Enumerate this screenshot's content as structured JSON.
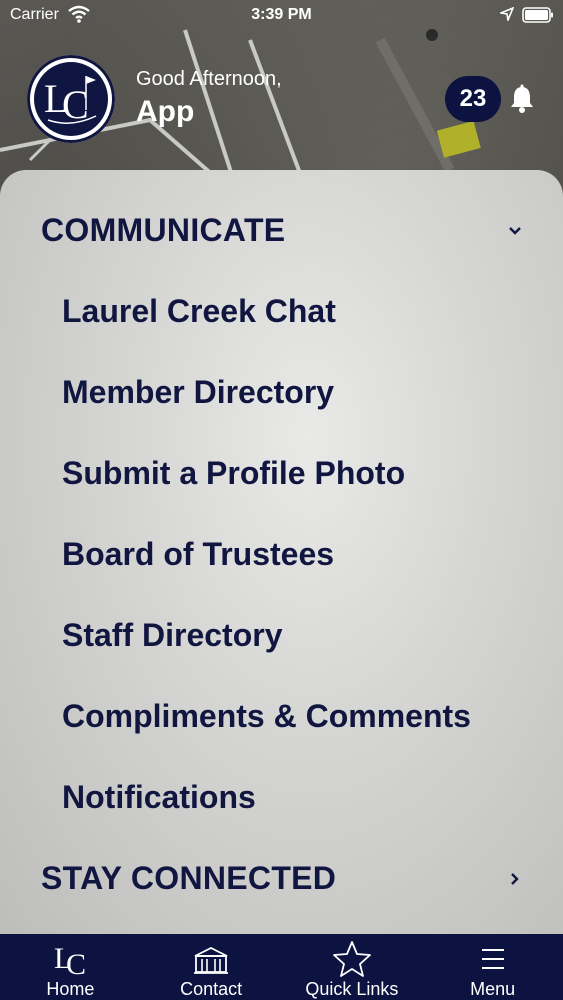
{
  "status_bar": {
    "carrier": "Carrier",
    "time": "3:39 PM"
  },
  "header": {
    "greeting": "Good Afternoon,",
    "username": "App",
    "notification_count": "23",
    "logo_text": "LC"
  },
  "menu": {
    "sections": [
      {
        "title": "COMMUNICATE",
        "expanded": true,
        "items": [
          "Laurel Creek Chat",
          "Member Directory",
          "Submit a Profile Photo",
          "Board of Trustees",
          "Staff Directory",
          "Compliments & Comments",
          "Notifications"
        ]
      },
      {
        "title": "STAY CONNECTED",
        "expanded": false,
        "items": []
      }
    ]
  },
  "tab_bar": {
    "tabs": [
      {
        "label": "Home",
        "icon": "lc-logo-icon"
      },
      {
        "label": "Contact",
        "icon": "building-icon"
      },
      {
        "label": "Quick Links",
        "icon": "star-icon"
      },
      {
        "label": "Menu",
        "icon": "hamburger-icon"
      }
    ]
  },
  "colors": {
    "brand_navy": "#0d1340",
    "panel": "#d9d9d7"
  }
}
